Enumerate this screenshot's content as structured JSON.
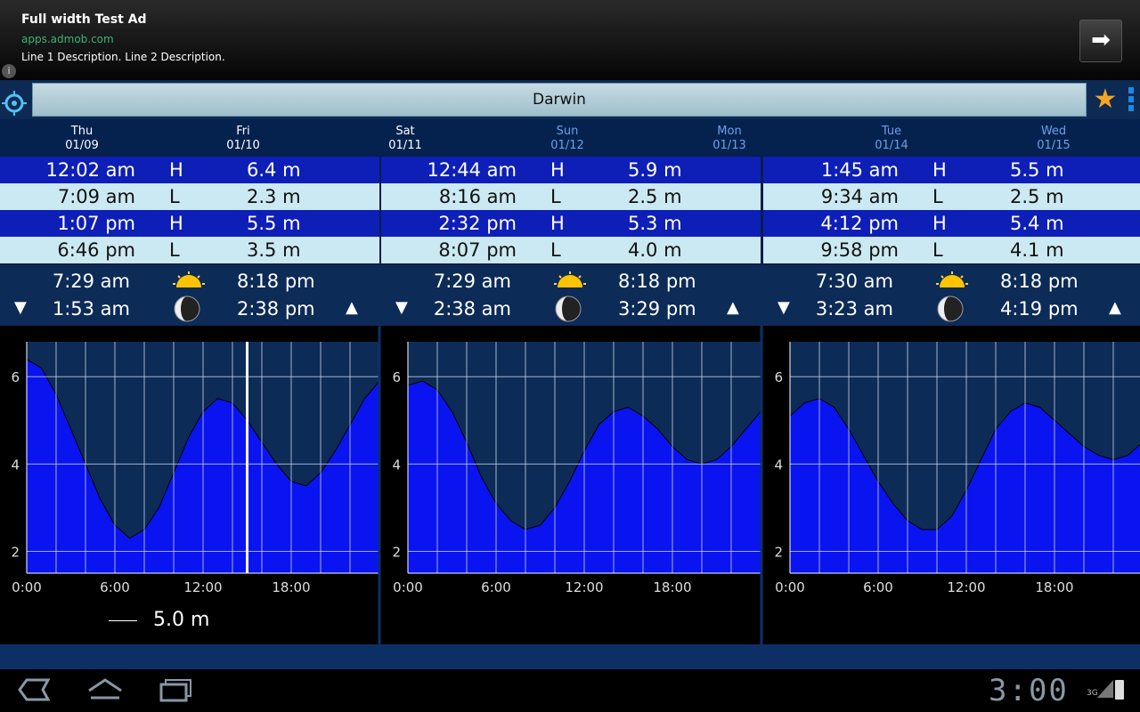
{
  "ad": {
    "title": "Full width Test Ad",
    "url": "apps.admob.com",
    "description": "Line 1 Description. Line 2 Description.",
    "info_icon": "i",
    "arrow_icon": "right-arrow-icon"
  },
  "header": {
    "location": "Darwin",
    "locate_icon": "crosshair-icon",
    "favorite_icon": "star-icon",
    "menu_icon": "overflow-menu-icon"
  },
  "days": [
    {
      "name": "Thu",
      "date": "01/09",
      "color": "#ffffff"
    },
    {
      "name": "Fri",
      "date": "01/10",
      "color": "#ffffff"
    },
    {
      "name": "Sat",
      "date": "01/11",
      "color": "#ffffff"
    },
    {
      "name": "Sun",
      "date": "01/12",
      "color": "#6f9fe6"
    },
    {
      "name": "Mon",
      "date": "01/13",
      "color": "#6f9fe6"
    },
    {
      "name": "Tue",
      "date": "01/14",
      "color": "#6f9fe6"
    },
    {
      "name": "Wed",
      "date": "01/15",
      "color": "#6f9fe6"
    }
  ],
  "tide_tables": [
    {
      "rows": [
        {
          "time": "12:02 am",
          "type": "H",
          "height": "6.4 m"
        },
        {
          "time": "7:09 am",
          "type": "L",
          "height": "2.3 m"
        },
        {
          "time": "1:07 pm",
          "type": "H",
          "height": "5.5 m"
        },
        {
          "time": "6:46 pm",
          "type": "L",
          "height": "3.5 m"
        }
      ],
      "sunrise": "7:29 am",
      "sunset": "8:18 pm",
      "moonset": "1:53 am",
      "moonrise": "2:38 pm"
    },
    {
      "rows": [
        {
          "time": "12:44 am",
          "type": "H",
          "height": "5.9 m"
        },
        {
          "time": "8:16 am",
          "type": "L",
          "height": "2.5 m"
        },
        {
          "time": "2:32 pm",
          "type": "H",
          "height": "5.3 m"
        },
        {
          "time": "8:07 pm",
          "type": "L",
          "height": "4.0 m"
        }
      ],
      "sunrise": "7:29 am",
      "sunset": "8:18 pm",
      "moonset": "2:38 am",
      "moonrise": "3:29 pm"
    },
    {
      "rows": [
        {
          "time": "1:45 am",
          "type": "H",
          "height": "5.5 m"
        },
        {
          "time": "9:34 am",
          "type": "L",
          "height": "2.5 m"
        },
        {
          "time": "4:12 pm",
          "type": "H",
          "height": "5.4 m"
        },
        {
          "time": "9:58 pm",
          "type": "L",
          "height": "4.1 m"
        }
      ],
      "sunrise": "7:30 am",
      "sunset": "8:18 pm",
      "moonset": "3:23 am",
      "moonrise": "4:19 pm"
    }
  ],
  "chart_data": [
    {
      "type": "area",
      "x": [
        0,
        1,
        2,
        3,
        4,
        5,
        6,
        7,
        8,
        9,
        10,
        11,
        12,
        13,
        14,
        15,
        16,
        17,
        18,
        19,
        20,
        21,
        22,
        23,
        24
      ],
      "y": [
        6.4,
        6.2,
        5.6,
        4.8,
        4.0,
        3.2,
        2.6,
        2.3,
        2.5,
        3.0,
        3.8,
        4.6,
        5.2,
        5.5,
        5.4,
        5.0,
        4.5,
        4.0,
        3.6,
        3.5,
        3.8,
        4.3,
        4.9,
        5.5,
        5.9
      ],
      "xticks": [
        "0:00",
        "6:00",
        "12:00",
        "18:00"
      ],
      "yticks": [
        "2",
        "4",
        "6"
      ],
      "ylim": [
        1.5,
        6.8
      ],
      "current_time": 15.0,
      "legend_label": "5.0 m",
      "fill_color": "#0a14f0"
    },
    {
      "type": "area",
      "x": [
        0,
        1,
        2,
        3,
        4,
        5,
        6,
        7,
        8,
        9,
        10,
        11,
        12,
        13,
        14,
        15,
        16,
        17,
        18,
        19,
        20,
        21,
        22,
        23,
        24
      ],
      "y": [
        5.8,
        5.9,
        5.7,
        5.2,
        4.5,
        3.7,
        3.1,
        2.7,
        2.5,
        2.6,
        3.0,
        3.6,
        4.3,
        4.9,
        5.2,
        5.3,
        5.1,
        4.8,
        4.4,
        4.1,
        4.0,
        4.1,
        4.4,
        4.8,
        5.2
      ],
      "xticks": [
        "0:00",
        "6:00",
        "12:00",
        "18:00"
      ],
      "yticks": [
        "2",
        "4",
        "6"
      ],
      "ylim": [
        1.5,
        6.8
      ],
      "fill_color": "#0a14f0"
    },
    {
      "type": "area",
      "x": [
        0,
        1,
        2,
        3,
        4,
        5,
        6,
        7,
        8,
        9,
        10,
        11,
        12,
        13,
        14,
        15,
        16,
        17,
        18,
        19,
        20,
        21,
        22,
        23,
        24
      ],
      "y": [
        5.1,
        5.4,
        5.5,
        5.3,
        4.8,
        4.2,
        3.6,
        3.1,
        2.7,
        2.5,
        2.5,
        2.8,
        3.4,
        4.1,
        4.8,
        5.2,
        5.4,
        5.3,
        5.0,
        4.7,
        4.4,
        4.2,
        4.1,
        4.2,
        4.5
      ],
      "xticks": [
        "0:00",
        "6:00",
        "12:00",
        "18:00"
      ],
      "yticks": [
        "2",
        "4",
        "6"
      ],
      "ylim": [
        1.5,
        6.8
      ],
      "fill_color": "#0a14f0"
    }
  ],
  "status_bar": {
    "clock": "3:00",
    "network": "3G",
    "back_icon": "back-icon",
    "home_icon": "home-icon",
    "recents_icon": "recent-apps-icon"
  }
}
